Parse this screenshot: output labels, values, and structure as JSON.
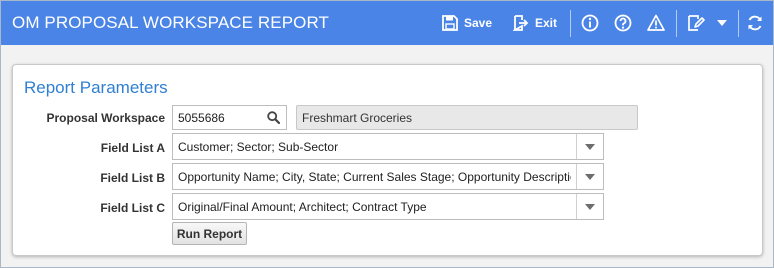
{
  "header": {
    "title": "OM PROPOSAL WORKSPACE REPORT",
    "save_label": "Save",
    "exit_label": "Exit",
    "icons": [
      "save-icon",
      "exit-icon",
      "info-icon",
      "help-icon",
      "warning-icon",
      "notes-icon",
      "dropdown-caret-icon",
      "refresh-icon"
    ]
  },
  "section": {
    "title": "Report Parameters"
  },
  "fields": {
    "proposal_workspace": {
      "label": "Proposal Workspace",
      "value": "5055686",
      "description": "Freshmart Groceries"
    },
    "field_list_a": {
      "label": "Field List A",
      "value": "Customer; Sector; Sub-Sector"
    },
    "field_list_b": {
      "label": "Field List B",
      "value": "Opportunity Name; City, State; Current Sales Stage; Opportunity Description"
    },
    "field_list_c": {
      "label": "Field List C",
      "value": "Original/Final Amount; Architect; Contract Type"
    }
  },
  "actions": {
    "run_report_label": "Run Report"
  },
  "colors": {
    "header_bg": "#4a84e6",
    "section_title": "#2f7fd3",
    "panel_bg": "#ffffff",
    "window_bg": "#f2f2f2"
  }
}
